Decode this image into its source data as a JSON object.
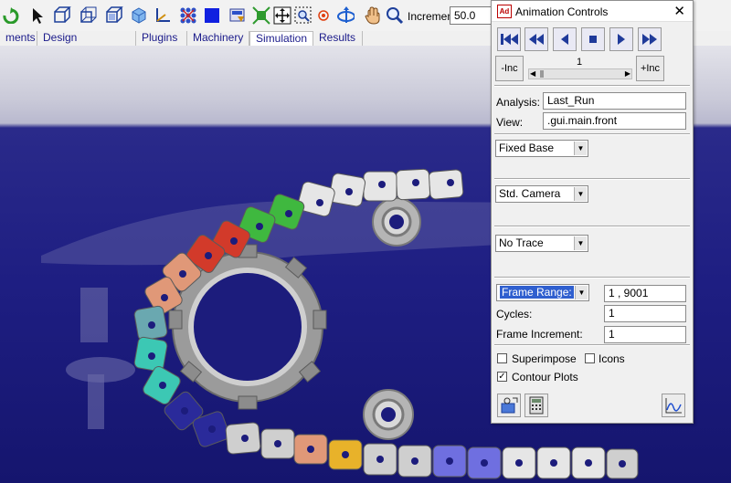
{
  "toolbar": {
    "increment_label": "Increment",
    "increment_value": "50.0",
    "icons": [
      "undo-icon",
      "select-arrow-icon",
      "box-view-icon",
      "wireframe-box-icon",
      "box-solid-icon",
      "cube-icon",
      "axis-triad-icon",
      "mesh-grid-icon",
      "blue-square-icon",
      "render-icon",
      "fit-icon",
      "fit-zoom-icon",
      "zoom-box-icon",
      "center-point-icon",
      "rotate-icon",
      "pan-hand-icon",
      "zoom-icon"
    ]
  },
  "tabs": [
    {
      "label": "ments"
    },
    {
      "label": "Design Exploration"
    },
    {
      "label": "Plugins"
    },
    {
      "label": "Machinery"
    },
    {
      "label": "Simulation",
      "active": true
    },
    {
      "label": "Results"
    }
  ],
  "dialog": {
    "app_icon_text": "Ad",
    "title": "Animation Controls",
    "close": "✕",
    "playback": [
      "rewind-to-start-icon",
      "step-back-icon",
      "play-reverse-icon",
      "stop-icon",
      "play-forward-icon",
      "fast-forward-icon"
    ],
    "dec_label": "-Inc",
    "inc_label": "+Inc",
    "frame_number": "1",
    "analysis_label": "Analysis:",
    "analysis_value": "Last_Run",
    "view_label": "View:",
    "view_value": ".gui.main.front",
    "base_select": "Fixed Base",
    "camera_select": "Std. Camera",
    "trace_select": "No Trace",
    "frame_range_select": "Frame Range:",
    "frame_range_value": "1 , 9001",
    "cycles_label": "Cycles:",
    "cycles_value": "1",
    "frame_increment_label": "Frame Increment:",
    "frame_increment_value": "1",
    "superimpose_label": "Superimpose",
    "superimpose_checked": false,
    "icons_label": "Icons",
    "icons_checked": false,
    "contour_plots_label": "Contour Plots",
    "contour_plots_checked": true
  },
  "colors": {
    "viewport_blue": "#1e1e82",
    "link_red": "#d23a2a",
    "link_green": "#3fb83f",
    "link_teal": "#3cc8b4",
    "link_navy": "#2a2a9a",
    "link_salmon": "#e09878",
    "link_yellow": "#e8b22a",
    "link_violet": "#6f6fe0",
    "link_white": "#e6e6e6",
    "playback_blue": "#1f3a9a"
  }
}
